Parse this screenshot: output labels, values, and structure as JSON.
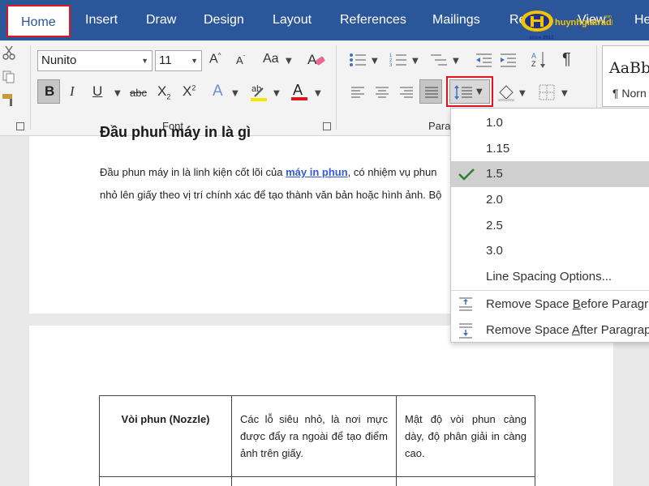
{
  "tabs": [
    {
      "label": "Home",
      "active": true
    },
    {
      "label": "Insert"
    },
    {
      "label": "Draw"
    },
    {
      "label": "Design"
    },
    {
      "label": "Layout"
    },
    {
      "label": "References"
    },
    {
      "label": "Mailings"
    },
    {
      "label": "Revi"
    },
    {
      "label": "View"
    },
    {
      "label": "He"
    }
  ],
  "logo": {
    "brand": "huynhgiatrading",
    "tld": ".com",
    "since": "since 2013"
  },
  "font": {
    "name": "Nunito",
    "size": "11",
    "group_label": "Font"
  },
  "paragraph": {
    "group_label": "Para"
  },
  "styles": {
    "sample": "AaBbC",
    "name": "¶ Norn"
  },
  "colors": {
    "tabbar": "#2b579a",
    "highlight": "#f5e600",
    "font_color": "#d9191f",
    "check": "#2e7d32",
    "link": "#2e5bd6"
  },
  "document": {
    "heading": "Đầu phun máy in là gì",
    "para_line1_before": "Đầu phun máy in là linh kiện cốt lõi của ",
    "para_link": "máy in phun",
    "para_line1_after": ", có nhiệm vụ phun",
    "para_line2": "nhỏ lên giấy theo vị trí chính xác để tạo thành văn bản hoặc hình ảnh. Bộ",
    "table": [
      [
        "Vòi phun (Nozzle)",
        "Các lỗ siêu nhỏ, là nơi mực được đẩy ra ngoài để tạo điểm ảnh trên giấy.",
        "Mật độ vòi phun càng dày, độ phân giải in càng cao."
      ]
    ]
  },
  "line_spacing_menu": {
    "options": [
      "1.0",
      "1.15",
      "1.5",
      "2.0",
      "2.5",
      "3.0"
    ],
    "selected": "1.5",
    "options_link": "Line Spacing Options...",
    "remove_before": {
      "pre": "Remove Space ",
      "u": "B",
      "post": "efore Paragr"
    },
    "remove_after": {
      "pre": "Remove Space ",
      "u": "A",
      "post": "fter Paragrap"
    }
  }
}
